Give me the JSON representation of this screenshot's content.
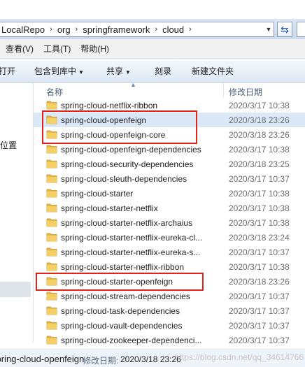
{
  "address": {
    "breadcrumbs": [
      "LocalRepo",
      "org",
      "springframework",
      "cloud"
    ],
    "refresh_glyph": "⇆"
  },
  "menu": [
    "查看(V)",
    "工具(T)",
    "帮助(H)"
  ],
  "commands": {
    "open": "打开",
    "include_in_library": "包含到库中",
    "share": "共享",
    "burn": "刻录",
    "new_folder": "新建文件夹"
  },
  "nav": {
    "partial_label": "位置"
  },
  "columns": {
    "name": "名称",
    "modified": "修改日期"
  },
  "files": [
    {
      "name": "spring-cloud-netflix-ribbon",
      "date": "2020/3/17 10:38"
    },
    {
      "name": "spring-cloud-openfeign",
      "date": "2020/3/18 23:26"
    },
    {
      "name": "spring-cloud-openfeign-core",
      "date": "2020/3/18 23:26"
    },
    {
      "name": "spring-cloud-openfeign-dependencies",
      "date": "2020/3/17 10:38"
    },
    {
      "name": "spring-cloud-security-dependencies",
      "date": "2020/3/18 23:25"
    },
    {
      "name": "spring-cloud-sleuth-dependencies",
      "date": "2020/3/17 10:37"
    },
    {
      "name": "spring-cloud-starter",
      "date": "2020/3/17 10:38"
    },
    {
      "name": "spring-cloud-starter-netflix",
      "date": "2020/3/17 10:38"
    },
    {
      "name": "spring-cloud-starter-netflix-archaius",
      "date": "2020/3/17 10:38"
    },
    {
      "name": "spring-cloud-starter-netflix-eureka-cl...",
      "date": "2020/3/18 23:24"
    },
    {
      "name": "spring-cloud-starter-netflix-eureka-s...",
      "date": "2020/3/17 10:37"
    },
    {
      "name": "spring-cloud-starter-netflix-ribbon",
      "date": "2020/3/17 10:38"
    },
    {
      "name": "spring-cloud-starter-openfeign",
      "date": "2020/3/18 23:26"
    },
    {
      "name": "spring-cloud-stream-dependencies",
      "date": "2020/3/17 10:37"
    },
    {
      "name": "spring-cloud-task-dependencies",
      "date": "2020/3/17 10:37"
    },
    {
      "name": "spring-cloud-vault-dependencies",
      "date": "2020/3/17 10:37"
    },
    {
      "name": "spring-cloud-zookeeper-dependenci...",
      "date": "2020/3/17 10:37"
    }
  ],
  "status": {
    "selected_name": "spring-cloud-openfeign",
    "modified_label": "修改日期:",
    "modified_value": "2020/3/18 23:26"
  },
  "watermark": "https://blog.csdn.net/qq_34614766",
  "colors": {
    "highlight": "#e2231a",
    "folder": "#e8b947",
    "selected_row": "#dbe8f8"
  }
}
